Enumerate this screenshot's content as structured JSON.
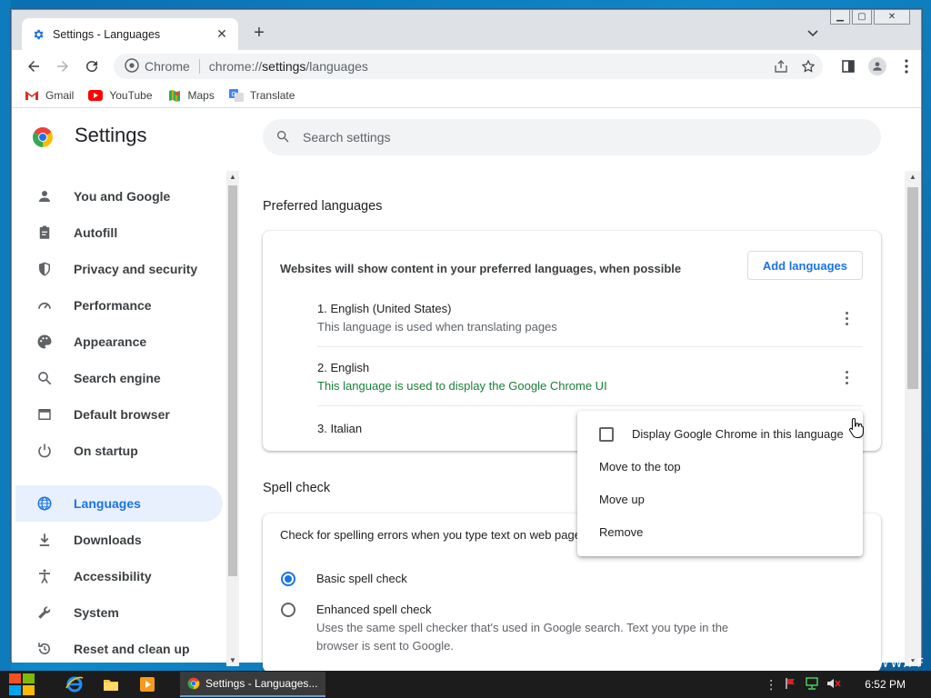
{
  "browser": {
    "tab_title": "Settings - Languages",
    "omnibox_label": "Chrome",
    "url_prefix": "chrome://",
    "url_host": "settings",
    "url_path": "/languages"
  },
  "bookmarks": [
    {
      "label": "Gmail",
      "icon": "gmail-icon"
    },
    {
      "label": "YouTube",
      "icon": "youtube-icon"
    },
    {
      "label": "Maps",
      "icon": "maps-icon"
    },
    {
      "label": "Translate",
      "icon": "translate-icon"
    }
  ],
  "settings": {
    "title": "Settings",
    "search_placeholder": "Search settings"
  },
  "sidebar": {
    "items": [
      {
        "label": "You and Google",
        "icon": "person-icon"
      },
      {
        "label": "Autofill",
        "icon": "clipboard-icon"
      },
      {
        "label": "Privacy and security",
        "icon": "shield-icon"
      },
      {
        "label": "Performance",
        "icon": "speedometer-icon"
      },
      {
        "label": "Appearance",
        "icon": "palette-icon"
      },
      {
        "label": "Search engine",
        "icon": "search-icon"
      },
      {
        "label": "Default browser",
        "icon": "browser-icon"
      },
      {
        "label": "On startup",
        "icon": "power-icon"
      },
      {
        "label": "Languages",
        "icon": "globe-icon",
        "active": true
      },
      {
        "label": "Downloads",
        "icon": "download-icon"
      },
      {
        "label": "Accessibility",
        "icon": "accessibility-icon"
      },
      {
        "label": "System",
        "icon": "wrench-icon"
      },
      {
        "label": "Reset and clean up",
        "icon": "reset-icon"
      }
    ]
  },
  "preferred_languages": {
    "heading": "Preferred languages",
    "description": "Websites will show content in your preferred languages, when possible",
    "add_button": "Add languages",
    "languages": [
      {
        "name": "1. English (United States)",
        "note": "This language is used when translating pages"
      },
      {
        "name": "2. English",
        "note": "This language is used to display the Google Chrome UI"
      },
      {
        "name": "3. Italian",
        "note": ""
      }
    ]
  },
  "context_menu": {
    "checkbox_label": "Display Google Chrome in this language",
    "checked": false,
    "items": [
      "Move to the top",
      "Move up",
      "Remove"
    ]
  },
  "spell_check": {
    "heading": "Spell check",
    "description": "Check for spelling errors when you type text on web page",
    "options": [
      {
        "label": "Basic spell check",
        "selected": true,
        "detail": ""
      },
      {
        "label": "Enhanced spell check",
        "selected": false,
        "detail_line1": "Uses the same spell checker that's used in Google search. Text you type in the",
        "detail_line2": "browser is sent to Google."
      }
    ]
  },
  "taskbar": {
    "active_task": "Settings - Languages...",
    "clock": "6:52 PM"
  },
  "watermark": "WWW.FF",
  "colors": {
    "accent": "#1a73e8",
    "green_note": "#188038",
    "active_bg": "#e8f0fe"
  }
}
